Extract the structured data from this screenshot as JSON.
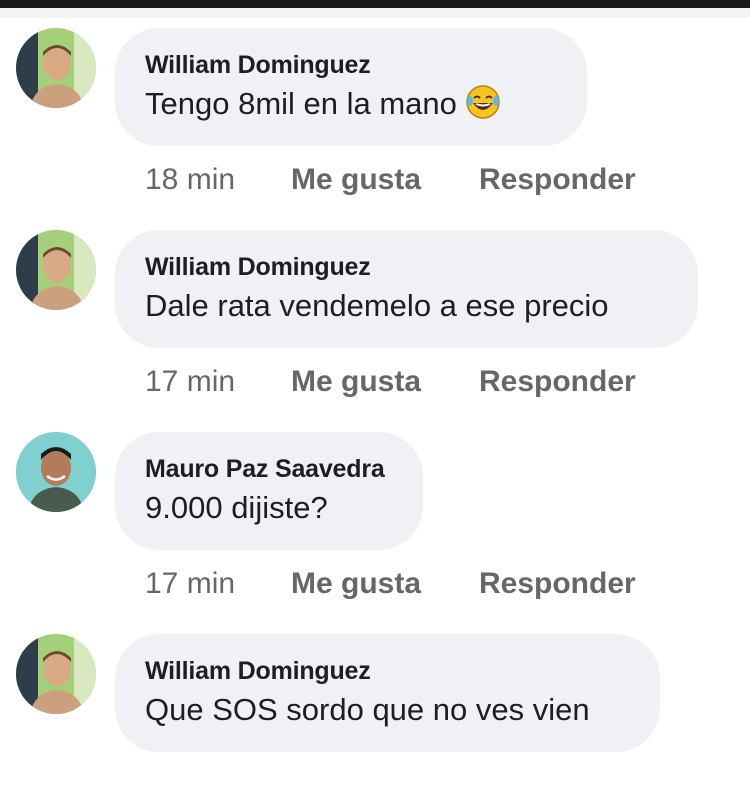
{
  "comments": [
    {
      "author": "William Dominguez",
      "text": "Tengo 8mil en la mano",
      "emoji": "face-with-tears-of-joy-icon",
      "time": "18 min",
      "like_label": "Me gusta",
      "reply_label": "Responder"
    },
    {
      "author": "William Dominguez",
      "text": "Dale rata vendemelo a ese precio",
      "time": "17 min",
      "like_label": "Me gusta",
      "reply_label": "Responder"
    },
    {
      "author": "Mauro Paz Saavedra",
      "text": "9.000 dijiste?",
      "time": "17 min",
      "like_label": "Me gusta",
      "reply_label": "Responder"
    },
    {
      "author": "William Dominguez",
      "text": "Que SOS sordo que no ves vien"
    }
  ],
  "colors": {
    "bubble": "#eff1f4",
    "text": "#1c1e21",
    "meta": "#65676b"
  }
}
